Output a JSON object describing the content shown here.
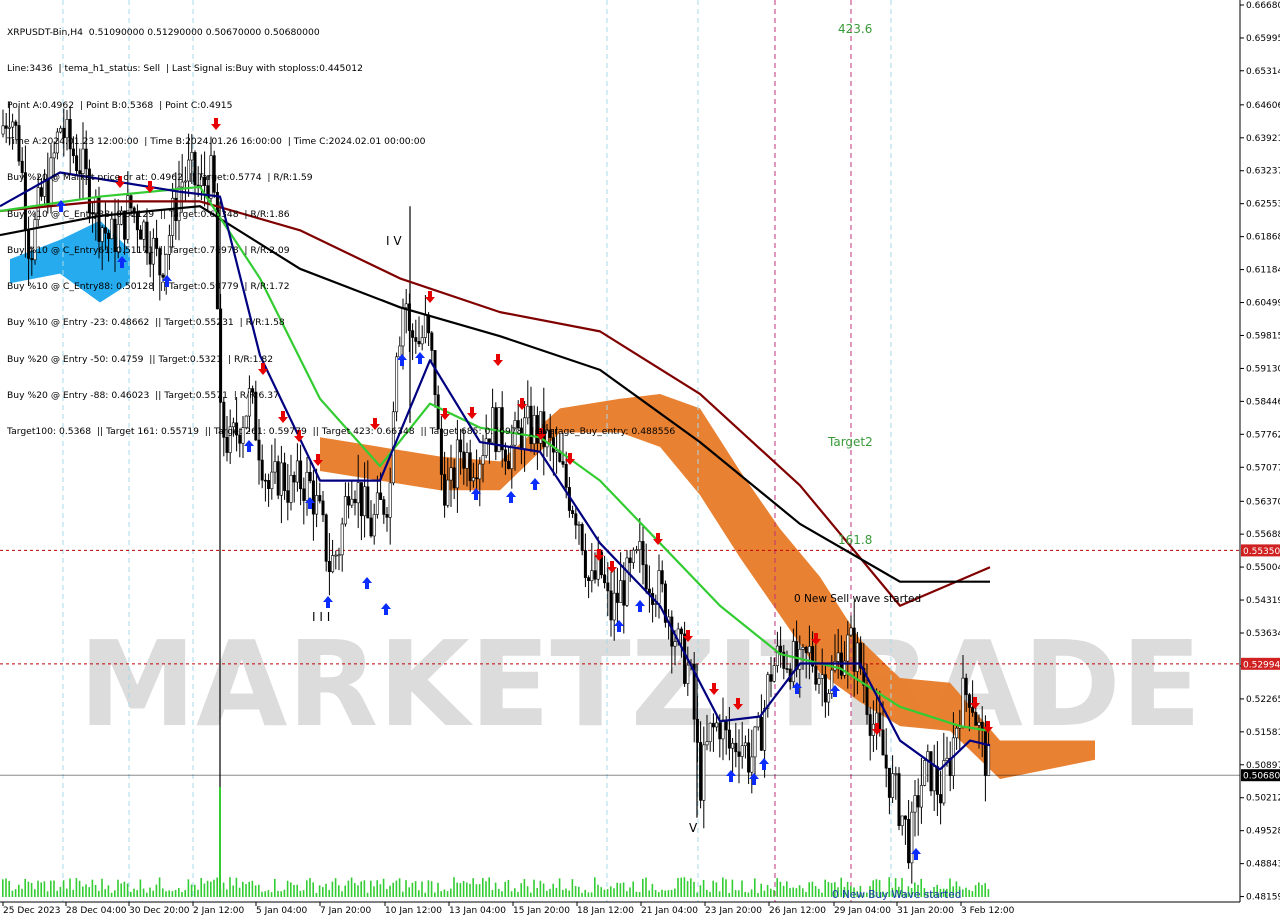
{
  "header": {
    "lines": [
      "XRPUSDT-Bin,H4  0.51090000 0.51290000 0.50670000 0.50680000",
      "Line:3436  | tema_h1_status: Sell  | Last Signal is:Buy with stoploss:0.445012",
      "Point A:0.4962  | Point B:0.5368  | Point C:0.4915",
      "Time A:2024.01.23 12:00:00  | Time B:2024.01.26 16:00:00  | Time C:2024.02.01 00:00:00",
      "Buy %20 @ Market price or at: 0.4962  || Target:0.5774  | R/R:1.59",
      "Buy %10 @ C_Entry38: 0.52129  || Target:0.66348  | R/R:1.86",
      "Buy %10 @ C_Entry61: 0.51171  || Target:0.76978  | R/R:2.09",
      "Buy %10 @ C_Entry88: 0.50128  || Target:0.59779  | R/R:1.72",
      "Buy %10 @ Entry -23: 0.48662  || Target:0.55231  | R/R:1.58",
      "Buy %20 @ Entry -50: 0.4759  || Target:0.5321  | R/R:1.82",
      "Buy %20 @ Entry -88: 0.46023  || Target:0.5571  | R/R:6.37",
      "Target100: 0.5368  || Target 161: 0.55719  || Target 261: 0.59779  || Target 423: 0.66348  || Target 685: 0.76978  || average_Buy_entry: 0.488556"
    ]
  },
  "watermark": "MARKETZITRADE",
  "annotations": {
    "level_423": "423.6",
    "target2": "Target2",
    "level_161": "161.8",
    "sell_wave": "0 New Sell wave started",
    "buy_wave": "0 New Buy Wave started",
    "mark_top": "I V",
    "mark_bottom": "I I I",
    "mark_v": "V"
  },
  "colors": {
    "up_arrow": "#0a2cff",
    "down_arrow": "#e60000",
    "ma_green": "#33cc33",
    "ma_navy": "#000080",
    "ma_black": "#000000",
    "ma_maroon": "#800000",
    "cloud_orange": "#e87a27",
    "cloud_blue": "#1aa7ee",
    "level_red": "#c00000",
    "price_tag": "#d02020",
    "current_price": "#000000"
  },
  "chart_data": {
    "type": "candlestick",
    "symbol": "XRPUSDT-Bin",
    "timeframe": "H4",
    "ohlc_last": {
      "open": 0.5109,
      "high": 0.5129,
      "low": 0.5067,
      "close": 0.5068
    },
    "ylim": [
      0.4815,
      0.6668
    ],
    "y_ticks": [
      "0.66680",
      "0.65995",
      "0.65314",
      "0.64606",
      "0.63921",
      "0.63237",
      "0.62553",
      "0.61868",
      "0.61184",
      "0.60499",
      "0.59815",
      "0.59130",
      "0.58446",
      "0.57762",
      "0.57077",
      "0.56370",
      "0.55688",
      "0.55004",
      "0.54319",
      "0.53634",
      "0.52949",
      "0.52265",
      "0.51581",
      "0.50897",
      "0.50212",
      "0.49528",
      "0.48843",
      "0.48159"
    ],
    "x_ticks": [
      "25 Dec 2023",
      "28 Dec 04:00",
      "30 Dec 20:00",
      "2 Jan 12:00",
      "5 Jan 04:00",
      "7 Jan 20:00",
      "10 Jan 12:00",
      "13 Jan 04:00",
      "15 Jan 20:00",
      "18 Jan 12:00",
      "21 Jan 04:00",
      "23 Jan 20:00",
      "26 Jan 12:00",
      "29 Jan 04:00",
      "31 Jan 20:00",
      "3 Feb 12:00"
    ],
    "price_levels": [
      {
        "label": "0.55350",
        "value": 0.5535,
        "color": "#c00000"
      },
      {
        "label": "0.52994",
        "value": 0.52994,
        "color": "#c00000"
      },
      {
        "label": "0.50680",
        "value": 0.5068,
        "color": "#000000"
      }
    ],
    "close_path": [
      [
        0,
        0.64
      ],
      [
        10,
        0.646
      ],
      [
        20,
        0.636
      ],
      [
        30,
        0.615
      ],
      [
        40,
        0.626
      ],
      [
        50,
        0.63
      ],
      [
        60,
        0.642
      ],
      [
        70,
        0.637
      ],
      [
        80,
        0.634
      ],
      [
        90,
        0.628
      ],
      [
        100,
        0.622
      ],
      [
        110,
        0.618
      ],
      [
        120,
        0.62
      ],
      [
        130,
        0.625
      ],
      [
        140,
        0.622
      ],
      [
        150,
        0.618
      ],
      [
        160,
        0.612
      ],
      [
        170,
        0.62
      ],
      [
        180,
        0.63
      ],
      [
        190,
        0.632
      ],
      [
        200,
        0.628
      ],
      [
        210,
        0.632
      ],
      [
        215,
        0.625
      ],
      [
        220,
        0.58
      ],
      [
        230,
        0.575
      ],
      [
        240,
        0.58
      ],
      [
        250,
        0.585
      ],
      [
        260,
        0.575
      ],
      [
        270,
        0.565
      ],
      [
        280,
        0.57
      ],
      [
        290,
        0.566
      ],
      [
        300,
        0.568
      ],
      [
        310,
        0.567
      ],
      [
        320,
        0.56
      ],
      [
        330,
        0.55
      ],
      [
        340,
        0.555
      ],
      [
        350,
        0.57
      ],
      [
        360,
        0.565
      ],
      [
        370,
        0.558
      ],
      [
        380,
        0.562
      ],
      [
        390,
        0.566
      ],
      [
        395,
        0.596
      ],
      [
        400,
        0.6
      ],
      [
        405,
        0.608
      ],
      [
        410,
        0.596
      ],
      [
        415,
        0.6
      ],
      [
        420,
        0.596
      ],
      [
        425,
        0.6
      ],
      [
        430,
        0.595
      ],
      [
        435,
        0.588
      ],
      [
        440,
        0.57
      ],
      [
        450,
        0.565
      ],
      [
        460,
        0.575
      ],
      [
        470,
        0.572
      ],
      [
        480,
        0.574
      ],
      [
        490,
        0.58
      ],
      [
        500,
        0.578
      ],
      [
        510,
        0.574
      ],
      [
        520,
        0.578
      ],
      [
        530,
        0.579
      ],
      [
        540,
        0.578
      ],
      [
        550,
        0.575
      ],
      [
        560,
        0.57
      ],
      [
        570,
        0.565
      ],
      [
        580,
        0.56
      ],
      [
        590,
        0.545
      ],
      [
        600,
        0.55
      ],
      [
        610,
        0.54
      ],
      [
        620,
        0.545
      ],
      [
        630,
        0.548
      ],
      [
        640,
        0.552
      ],
      [
        650,
        0.548
      ],
      [
        660,
        0.545
      ],
      [
        670,
        0.54
      ],
      [
        680,
        0.532
      ],
      [
        690,
        0.528
      ],
      [
        700,
        0.505
      ],
      [
        710,
        0.515
      ],
      [
        720,
        0.518
      ],
      [
        730,
        0.512
      ],
      [
        740,
        0.515
      ],
      [
        750,
        0.51
      ],
      [
        760,
        0.515
      ],
      [
        770,
        0.528
      ],
      [
        780,
        0.532
      ],
      [
        790,
        0.531
      ],
      [
        800,
        0.528
      ],
      [
        810,
        0.532
      ],
      [
        820,
        0.528
      ],
      [
        830,
        0.526
      ],
      [
        840,
        0.532
      ],
      [
        850,
        0.534
      ],
      [
        860,
        0.53
      ],
      [
        870,
        0.52
      ],
      [
        880,
        0.513
      ],
      [
        890,
        0.506
      ],
      [
        900,
        0.5
      ],
      [
        910,
        0.492
      ],
      [
        920,
        0.505
      ],
      [
        930,
        0.508
      ],
      [
        940,
        0.503
      ],
      [
        950,
        0.51
      ],
      [
        960,
        0.522
      ],
      [
        970,
        0.525
      ],
      [
        980,
        0.515
      ],
      [
        990,
        0.507
      ]
    ],
    "series": [
      {
        "name": "",
        "color": "#800000",
        "points": [
          [
            0,
            0.624
          ],
          [
            100,
            0.626
          ],
          [
            200,
            0.626
          ],
          [
            300,
            0.62
          ],
          [
            400,
            0.61
          ],
          [
            500,
            0.603
          ],
          [
            600,
            0.599
          ],
          [
            700,
            0.586
          ],
          [
            800,
            0.567
          ],
          [
            900,
            0.542
          ],
          [
            990,
            0.55
          ]
        ]
      },
      {
        "name": "",
        "color": "#000000",
        "points": [
          [
            0,
            0.619
          ],
          [
            100,
            0.623
          ],
          [
            200,
            0.625
          ],
          [
            300,
            0.612
          ],
          [
            400,
            0.604
          ],
          [
            500,
            0.598
          ],
          [
            600,
            0.591
          ],
          [
            700,
            0.576
          ],
          [
            800,
            0.559
          ],
          [
            900,
            0.547
          ],
          [
            990,
            0.547
          ]
        ]
      },
      {
        "name": "",
        "color": "#33cc33",
        "points": [
          [
            0,
            0.624
          ],
          [
            100,
            0.627
          ],
          [
            200,
            0.629
          ],
          [
            260,
            0.61
          ],
          [
            320,
            0.585
          ],
          [
            380,
            0.571
          ],
          [
            430,
            0.584
          ],
          [
            480,
            0.579
          ],
          [
            540,
            0.577
          ],
          [
            600,
            0.568
          ],
          [
            660,
            0.555
          ],
          [
            720,
            0.542
          ],
          [
            780,
            0.532
          ],
          [
            840,
            0.529
          ],
          [
            900,
            0.521
          ],
          [
            960,
            0.517
          ],
          [
            990,
            0.516
          ]
        ]
      },
      {
        "name": "",
        "color": "#000080",
        "points": [
          [
            0,
            0.625
          ],
          [
            60,
            0.632
          ],
          [
            120,
            0.63
          ],
          [
            180,
            0.628
          ],
          [
            220,
            0.627
          ],
          [
            260,
            0.594
          ],
          [
            320,
            0.568
          ],
          [
            380,
            0.568
          ],
          [
            430,
            0.593
          ],
          [
            480,
            0.576
          ],
          [
            540,
            0.574
          ],
          [
            600,
            0.555
          ],
          [
            660,
            0.542
          ],
          [
            720,
            0.518
          ],
          [
            760,
            0.519
          ],
          [
            800,
            0.53
          ],
          [
            860,
            0.53
          ],
          [
            900,
            0.514
          ],
          [
            940,
            0.508
          ],
          [
            970,
            0.514
          ],
          [
            990,
            0.513
          ]
        ]
      }
    ],
    "clouds": [
      {
        "color": "#e87a27",
        "upper": [
          [
            320,
            0.577
          ],
          [
            380,
            0.575
          ],
          [
            440,
            0.573
          ],
          [
            500,
            0.572
          ],
          [
            560,
            0.583
          ],
          [
            620,
            0.585
          ],
          [
            660,
            0.586
          ],
          [
            700,
            0.583
          ],
          [
            740,
            0.57
          ],
          [
            780,
            0.558
          ],
          [
            820,
            0.548
          ],
          [
            860,
            0.535
          ],
          [
            900,
            0.527
          ],
          [
            950,
            0.526
          ],
          [
            1000,
            0.514
          ],
          [
            1095,
            0.514
          ]
        ],
        "lower": [
          [
            320,
            0.57
          ],
          [
            380,
            0.568
          ],
          [
            440,
            0.566
          ],
          [
            500,
            0.566
          ],
          [
            560,
            0.578
          ],
          [
            620,
            0.578
          ],
          [
            660,
            0.575
          ],
          [
            700,
            0.565
          ],
          [
            740,
            0.552
          ],
          [
            780,
            0.54
          ],
          [
            820,
            0.528
          ],
          [
            860,
            0.522
          ],
          [
            900,
            0.517
          ],
          [
            950,
            0.516
          ],
          [
            1000,
            0.506
          ],
          [
            1095,
            0.51
          ]
        ]
      },
      {
        "color": "#1aa7ee",
        "upper": [
          [
            10,
            0.614
          ],
          [
            60,
            0.618
          ],
          [
            100,
            0.622
          ],
          [
            130,
            0.616
          ]
        ],
        "lower": [
          [
            10,
            0.609
          ],
          [
            60,
            0.611
          ],
          [
            100,
            0.605
          ],
          [
            130,
            0.609
          ]
        ]
      }
    ]
  }
}
